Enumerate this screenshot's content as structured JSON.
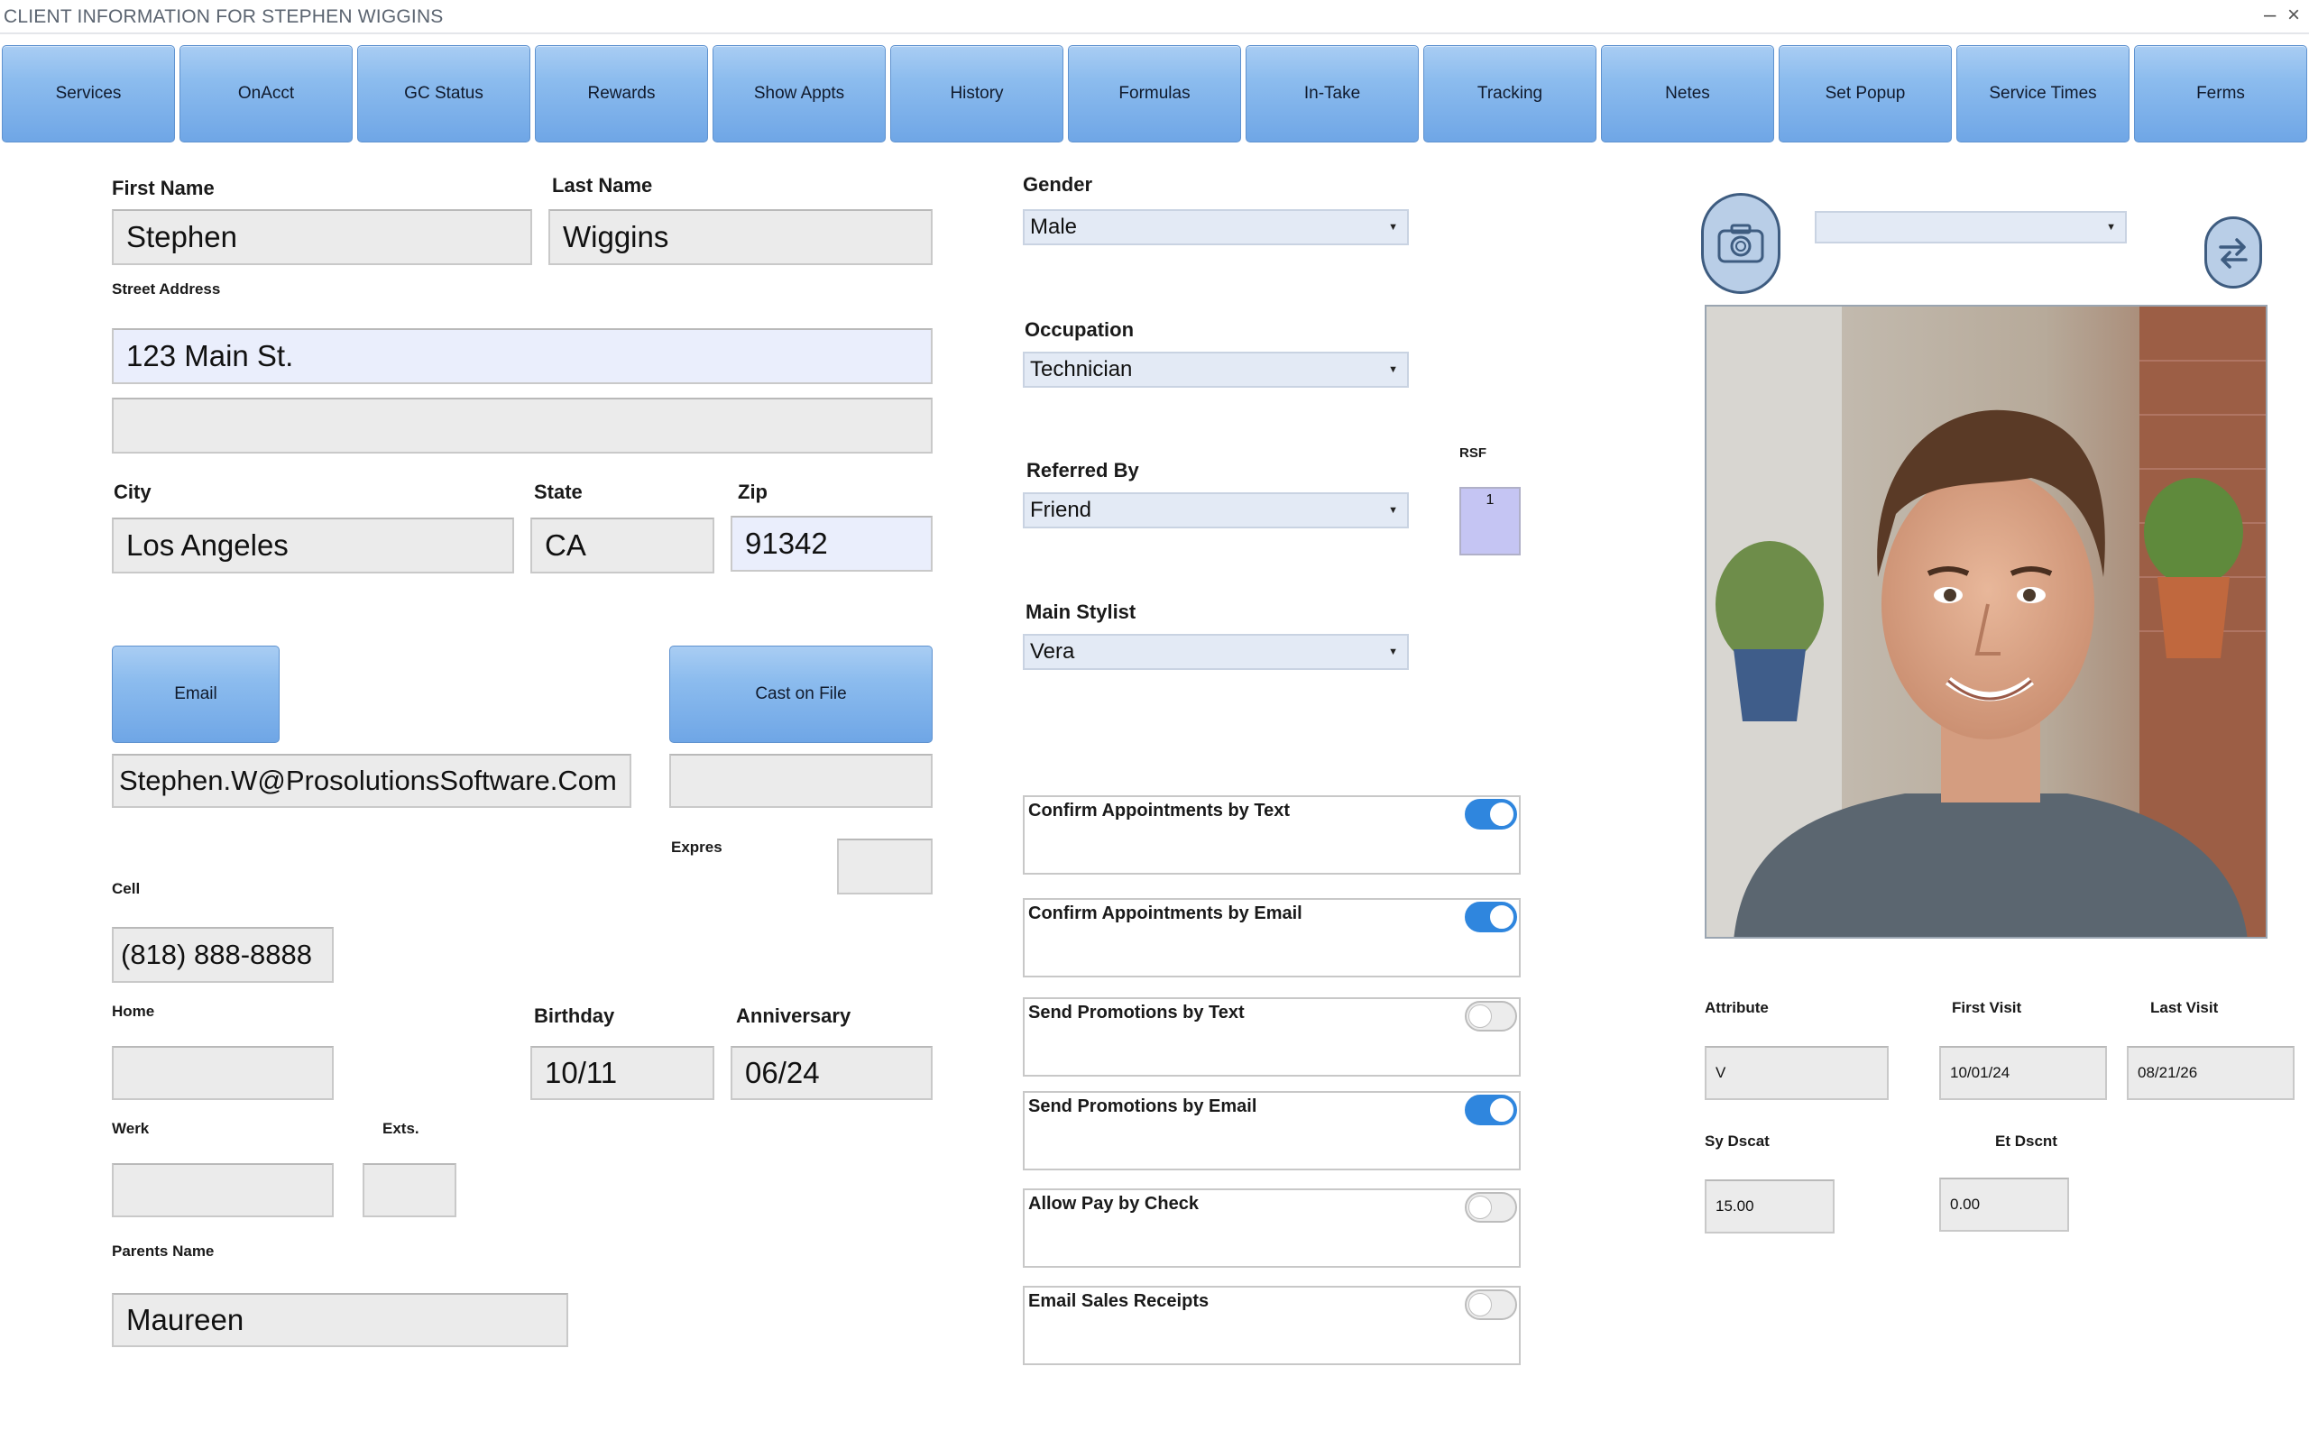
{
  "window": {
    "title": "CLIENT INFORMATION FOR STEPHEN WIGGINS",
    "minimize": "–",
    "close": "×"
  },
  "nav": [
    "Services",
    "OnAcct",
    "GC Status",
    "Rewards",
    "Show Appts",
    "History",
    "Formulas",
    "In-Take",
    "Tracking",
    "Netes",
    "Set Popup",
    "Service Times",
    "Ferms"
  ],
  "labels": {
    "first_name": "First Name",
    "last_name": "Last Name",
    "street": "Street Address",
    "city": "City",
    "state": "State",
    "zip": "Zip",
    "expires": "Expres",
    "cell": "Cell",
    "home": "Home",
    "birthday": "Birthday",
    "anniversary": "Anniversary",
    "work": "Werk",
    "ext": "Exts.",
    "parents_name": "Parents Name",
    "gender": "Gender",
    "occupation": "Occupation",
    "referred_by": "Referred By",
    "rsf": "RSF",
    "main_stylist": "Main Stylist",
    "attribute": "Attribute",
    "first_visit": "First Visit",
    "last_visit": "Last Visit",
    "sv_discount": "Sy Dscat",
    "et_discount": "Et Dscnt"
  },
  "values": {
    "first_name": "Stephen",
    "last_name": "Wiggins",
    "street1": "123 Main St.",
    "street2": "",
    "city": "Los Angeles",
    "state": "CA",
    "zip": "91342",
    "email": "Stephen.W@ProsolutionsSoftware.Com",
    "card": "",
    "expires": "",
    "cell": "(818) 888-8888",
    "home": "",
    "birthday": "10/11",
    "anniversary": "06/24",
    "work": "",
    "ext": "",
    "parents_name": "Maureen",
    "gender": "Male",
    "occupation": "Technician",
    "referred_by": "Friend",
    "rsf": "1",
    "main_stylist": "Vera",
    "photo_select": "",
    "attribute": "V",
    "first_visit": "10/01/24",
    "last_visit": "08/21/26",
    "sv_discount": "15.00",
    "et_discount": "0.00"
  },
  "buttons": {
    "email": "Email",
    "card_on_file": "Cast on File"
  },
  "toggles": [
    {
      "label": "Confirm Appointments by Text",
      "on": true
    },
    {
      "label": "Confirm Appointments by Email",
      "on": true
    },
    {
      "label": "Send Promotions by Text",
      "on": false
    },
    {
      "label": "Send Promotions by Email",
      "on": true
    },
    {
      "label": "Allow Pay by Check",
      "on": false
    },
    {
      "label": "Email Sales Receipts",
      "on": false
    }
  ],
  "icons": {
    "camera": "camera-icon",
    "swap": "swap-arrows-icon"
  },
  "colors": {
    "nav_gradient_top": "#a9cdf3",
    "nav_gradient_bottom": "#6fa6e6",
    "toggle_on": "#2f86de",
    "field_bg": "#ebebeb",
    "rsf_bg": "#c5c5f3"
  }
}
